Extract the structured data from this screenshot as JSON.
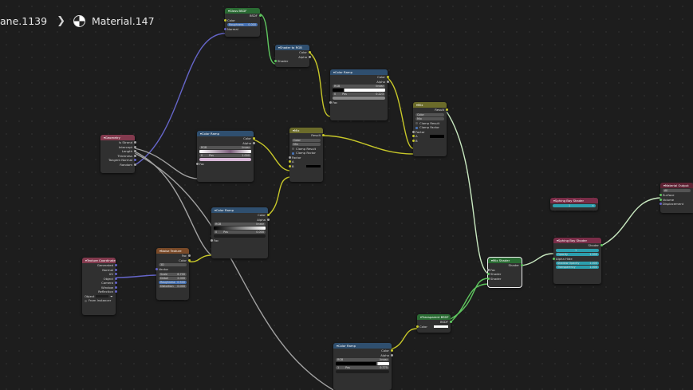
{
  "breadcrumb": {
    "object": "ane.1139",
    "material": "Material.147"
  },
  "colors": {
    "shader_socket": "#5fc65f",
    "color_socket": "#c7c729",
    "vector_socket": "#6363c7",
    "float_socket": "#a1a1a1"
  },
  "gloss_bsdf": {
    "title": "Gloss BSDF",
    "out_bsdf": "BSDF",
    "color": "Color",
    "roughness": "Roughness",
    "roughness_value": "0.000",
    "normal": "Normal"
  },
  "shader_to_rgb": {
    "title": "Shader to RGB",
    "out_color": "Color",
    "out_alpha": "Alpha",
    "in_shader": "Shader"
  },
  "color_ramp_1": {
    "title": "Color Ramp",
    "out_color": "Color",
    "out_alpha": "Alpha",
    "mode": "RGB",
    "interp": "linear",
    "index": "0",
    "pos_label": "Pos",
    "pos_value": "0.223",
    "in_fac": "Fac"
  },
  "mix_right": {
    "title": "Mix",
    "out_result": "Result",
    "data_type": "Color",
    "blend": "Mix",
    "clamp_result": "Clamp Result",
    "clamp_factor": "Clamp Factor",
    "fac": "Factor",
    "a": "A",
    "b": "B"
  },
  "geometry": {
    "title": "Geometry",
    "out_is_strand": "Is Strand",
    "out_intercept": "Intercept",
    "out_length": "Length",
    "out_thickness": "Thickness",
    "out_tangent_normal": "Tangent Normal",
    "out_random": "Random"
  },
  "color_ramp_2": {
    "title": "Color Ramp",
    "out_color": "Color",
    "out_alpha": "Alpha",
    "mode": "RGB",
    "interp": "linear",
    "index": "0",
    "pos_label": "Pos",
    "pos_value": "1.000",
    "in_fac": "Fac"
  },
  "mix_mid": {
    "title": "Mix",
    "out_result": "Result",
    "data_type": "Color",
    "blend": "Mix",
    "clamp_result": "Clamp Result",
    "clamp_factor": "Clamp Factor",
    "fac": "Factor",
    "a": "A",
    "b": "B"
  },
  "color_ramp_3": {
    "title": "Color Ramp",
    "out_color": "Color",
    "out_alpha": "Alpha",
    "mode": "RGB",
    "interp": "linear",
    "index": "0",
    "pos_label": "Pos",
    "pos_value": "0.000",
    "in_fac": "Fac"
  },
  "tex_coord": {
    "title": "Texture Coordinate",
    "out_generated": "Generated",
    "out_normal": "Normal",
    "out_uv": "UV",
    "out_object": "Object",
    "out_camera": "Camera",
    "out_window": "Window",
    "out_reflection": "Reflection",
    "object_label": "Object",
    "from_instancer": "From Instancer"
  },
  "noise_tex": {
    "title": "Noise Texture",
    "out_fac": "Fac",
    "out_color": "Color",
    "dim": "3D",
    "in_vector": "Vector",
    "scale_label": "Scale",
    "scale_value": "6.700",
    "detail_label": "Detail",
    "detail_value": "2.000",
    "roughness_label": "Roughness",
    "roughness_value": "0.500",
    "distortion_label": "Distortion",
    "distortion_value": "0.000"
  },
  "mix_shader": {
    "title": "Mix Shader",
    "out_shader": "Shader",
    "fac": "Fac",
    "in_shader_1": "Shader",
    "in_shader_2": "Shader"
  },
  "transparent_bsdf": {
    "title": "Transparent BSDF",
    "out_bsdf": "BSDF",
    "color": "Color"
  },
  "color_ramp_4": {
    "title": "Color Ramp",
    "out_color": "Color",
    "out_alpha": "Alpha",
    "mode": "RGB",
    "interp": "linear",
    "index": "1",
    "pos_label": "Pos",
    "pos_value": "0.775"
  },
  "group_small": {
    "title": "Sphing Bay Shader",
    "value": "1"
  },
  "group_big": {
    "title": "Sphing Bay Shader",
    "out_shader": "Shader",
    "value": "1",
    "opacity_label": "Opacity",
    "opacity_value": "1.000",
    "alpha_hide": "Alpha Hide",
    "shadow_opacity_label": "Shadow Opacity",
    "shadow_opacity_value": "1.000",
    "transparency_label": "Transparency",
    "transparency_value": "1.000"
  },
  "material_output": {
    "title": "Material Output",
    "target": "All",
    "surface": "Surface",
    "volume": "Volume",
    "displacement": "Displacement"
  }
}
